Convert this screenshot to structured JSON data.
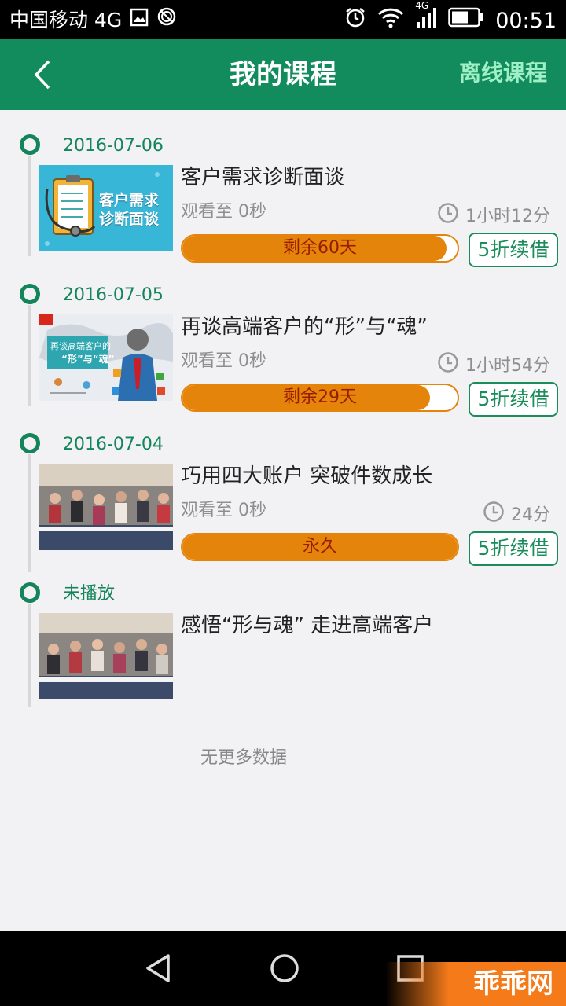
{
  "status_bar": {
    "carrier": "中国移动 4G",
    "network_badge": "4G",
    "time": "00:51",
    "icons": [
      "gallery-icon",
      "sync-icon",
      "alarm-icon",
      "wifi-icon",
      "signal-icon",
      "battery-icon"
    ]
  },
  "header": {
    "title": "我的课程",
    "right_link": "离线课程",
    "bg_color": "#128c5c"
  },
  "courses": [
    {
      "date": "2016-07-06",
      "title": "客户需求诊断面谈",
      "watched": "观看至 0秒",
      "duration": "1小时12分",
      "remaining_label": "剩余60天",
      "progress": 0.96,
      "renew_label": "5折续借",
      "thumb_text": [
        "客户需求",
        "诊断面谈"
      ]
    },
    {
      "date": "2016-07-05",
      "title": "再谈高端客户的“形”与“魂”",
      "watched": "观看至 0秒",
      "duration": "1小时54分",
      "remaining_label": "剩余29天",
      "progress": 0.9,
      "renew_label": "5折续借",
      "thumb_text": [
        "再谈高端客户的",
        "“形”与“魂”"
      ]
    },
    {
      "date": "2016-07-04",
      "title": "巧用四大账户 突破件数成长",
      "watched": "观看至 0秒",
      "duration": "24分",
      "remaining_label": "永久",
      "progress": 1.0,
      "renew_label": "5折续借"
    },
    {
      "date": "未播放",
      "title": "感悟“形与魂” 走进高端客户"
    }
  ],
  "footer_text": "无更多数据",
  "accent_color": "#14845a",
  "progress_color": "#e5840a",
  "watermark": "乖乖网"
}
